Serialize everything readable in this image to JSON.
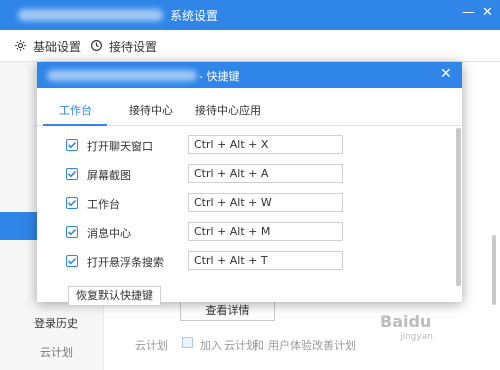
{
  "window": {
    "title": "系统设置",
    "minimize": "—",
    "close": "✕"
  },
  "top_tabs": [
    {
      "label": "基础设置",
      "icon": "gear-icon"
    },
    {
      "label": "接待设置",
      "icon": "clock-icon"
    }
  ],
  "sidebar": {
    "items": [
      {
        "label": "登录历史"
      },
      {
        "label": "云计划"
      }
    ]
  },
  "main": {
    "detail_button": "查看详情",
    "cloud_label": "云计划",
    "cloud_join": "加入",
    "cloud_link1": "云计划",
    "cloud_and": "和",
    "cloud_link2": "用户体验改善计划"
  },
  "modal": {
    "title": "- 快捷键",
    "close": "✕",
    "tabs": [
      {
        "label": "工作台",
        "active": true
      },
      {
        "label": "接待中心",
        "active": false
      },
      {
        "label": "接待中心应用",
        "active": false
      }
    ],
    "shortcuts": [
      {
        "label": "打开聊天窗口",
        "key": "Ctrl + Alt + X",
        "checked": true
      },
      {
        "label": "屏幕截图",
        "key": "Ctrl + Alt + A",
        "checked": true
      },
      {
        "label": "工作台",
        "key": "Ctrl + Alt + W",
        "checked": true
      },
      {
        "label": "消息中心",
        "key": "Ctrl + Alt + M",
        "checked": true
      },
      {
        "label": "打开悬浮条搜索",
        "key": "Ctrl + Alt + T",
        "checked": true
      }
    ],
    "reset_button": "恢复默认快捷键"
  },
  "watermark": {
    "text": "Baidu",
    "sub": "jingyan"
  },
  "colors": {
    "accent": "#2f86e8",
    "text": "#333333",
    "muted": "#9a9a9a"
  }
}
